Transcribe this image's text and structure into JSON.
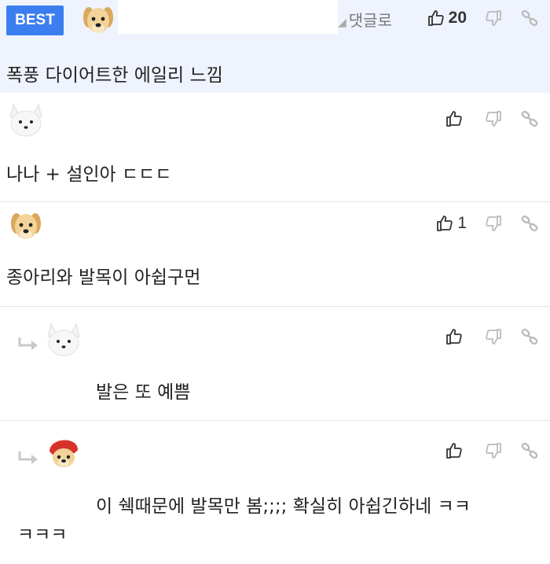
{
  "best_badge": "BEST",
  "comments": [
    {
      "reply_to_label": "댓글로",
      "like_count": "20",
      "text": "폭풍 다이어트한 에일리 느낌"
    },
    {
      "like_count": "",
      "text": "나나 + 설인아 ㄷㄷㄷ"
    },
    {
      "like_count": "1",
      "text": "종아리와 발목이 아쉽구먼"
    },
    {
      "like_count": "",
      "text": "발은 또 예쁨"
    },
    {
      "like_count": "",
      "text_line1": "이 쉑때문에 발목만 봄;;;; 확실히 아쉽긴하네 ㅋㅋ",
      "text_line2": "ㅋㅋㅋ"
    }
  ],
  "colors": {
    "best_bg": "#eef3fd",
    "badge": "#3b7ef0"
  },
  "icons": [
    "thumbs-up-icon",
    "thumbs-down-icon",
    "link-icon",
    "reply-arrow-icon"
  ]
}
